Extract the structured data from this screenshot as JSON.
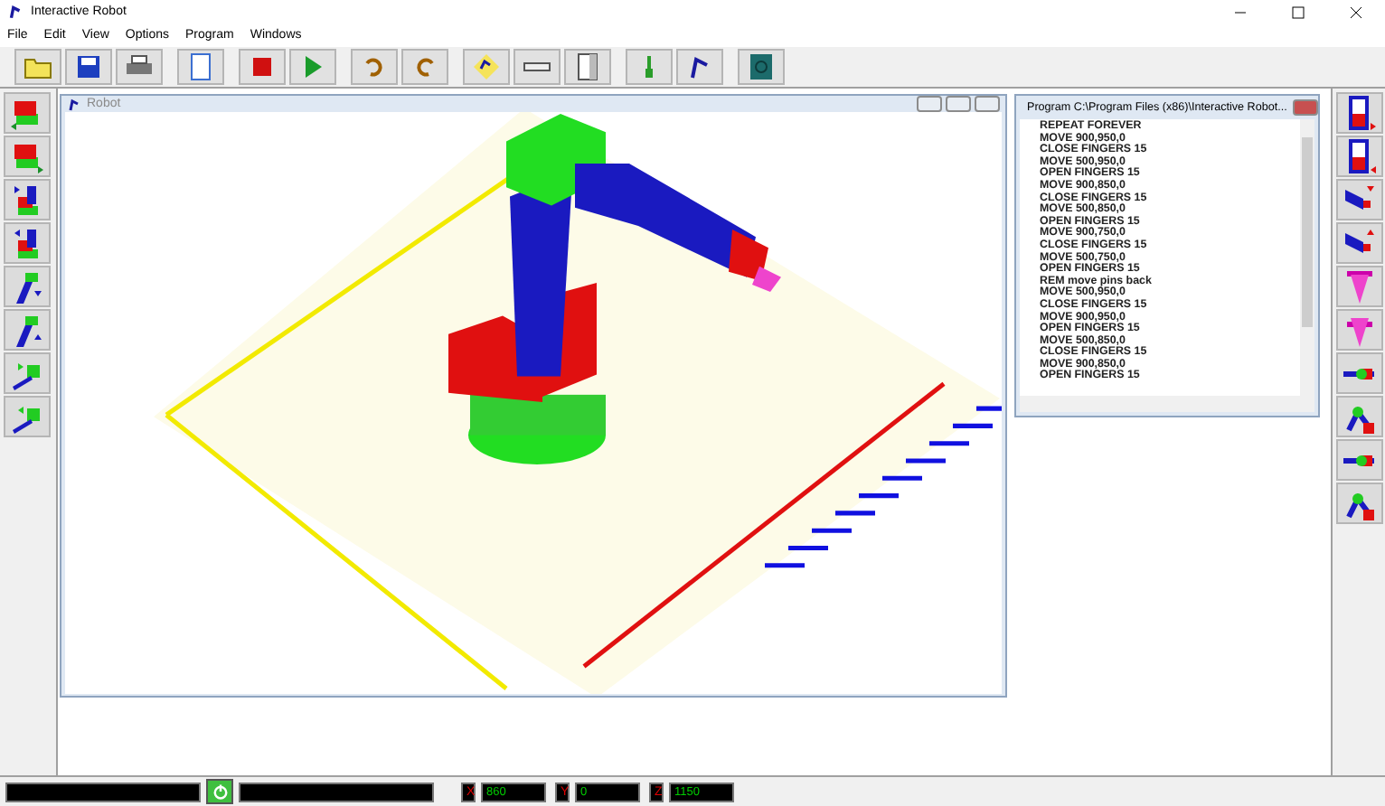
{
  "window": {
    "title": "Interactive Robot"
  },
  "menu": [
    "File",
    "Edit",
    "View",
    "Options",
    "Program",
    "Windows"
  ],
  "robot_window": {
    "title": "Robot"
  },
  "program_window": {
    "title": "Program C:\\Program Files (x86)\\Interactive Robot...",
    "lines": [
      "REPEAT FOREVER",
      "MOVE 900,950,0",
      "CLOSE FINGERS 15",
      "MOVE 500,950,0",
      "OPEN FINGERS 15",
      "MOVE 900,850,0",
      "CLOSE FINGERS 15",
      "MOVE 500,850,0",
      "OPEN FINGERS 15",
      "MOVE 900,750,0",
      "CLOSE FINGERS 15",
      "MOVE 500,750,0",
      "OPEN FINGERS 15",
      "REM move pins back",
      "MOVE 500,950,0",
      "CLOSE FINGERS 15",
      "MOVE 900,950,0",
      "OPEN FINGERS 15",
      "MOVE 500,850,0",
      "CLOSE FINGERS 15",
      "MOVE 900,850,0",
      "OPEN FINGERS 15"
    ]
  },
  "status_bar": {
    "coordinates": [
      {
        "label": "X",
        "value": "860"
      },
      {
        "label": "Y",
        "value": "0"
      },
      {
        "label": "Z",
        "value": "1150"
      }
    ]
  }
}
